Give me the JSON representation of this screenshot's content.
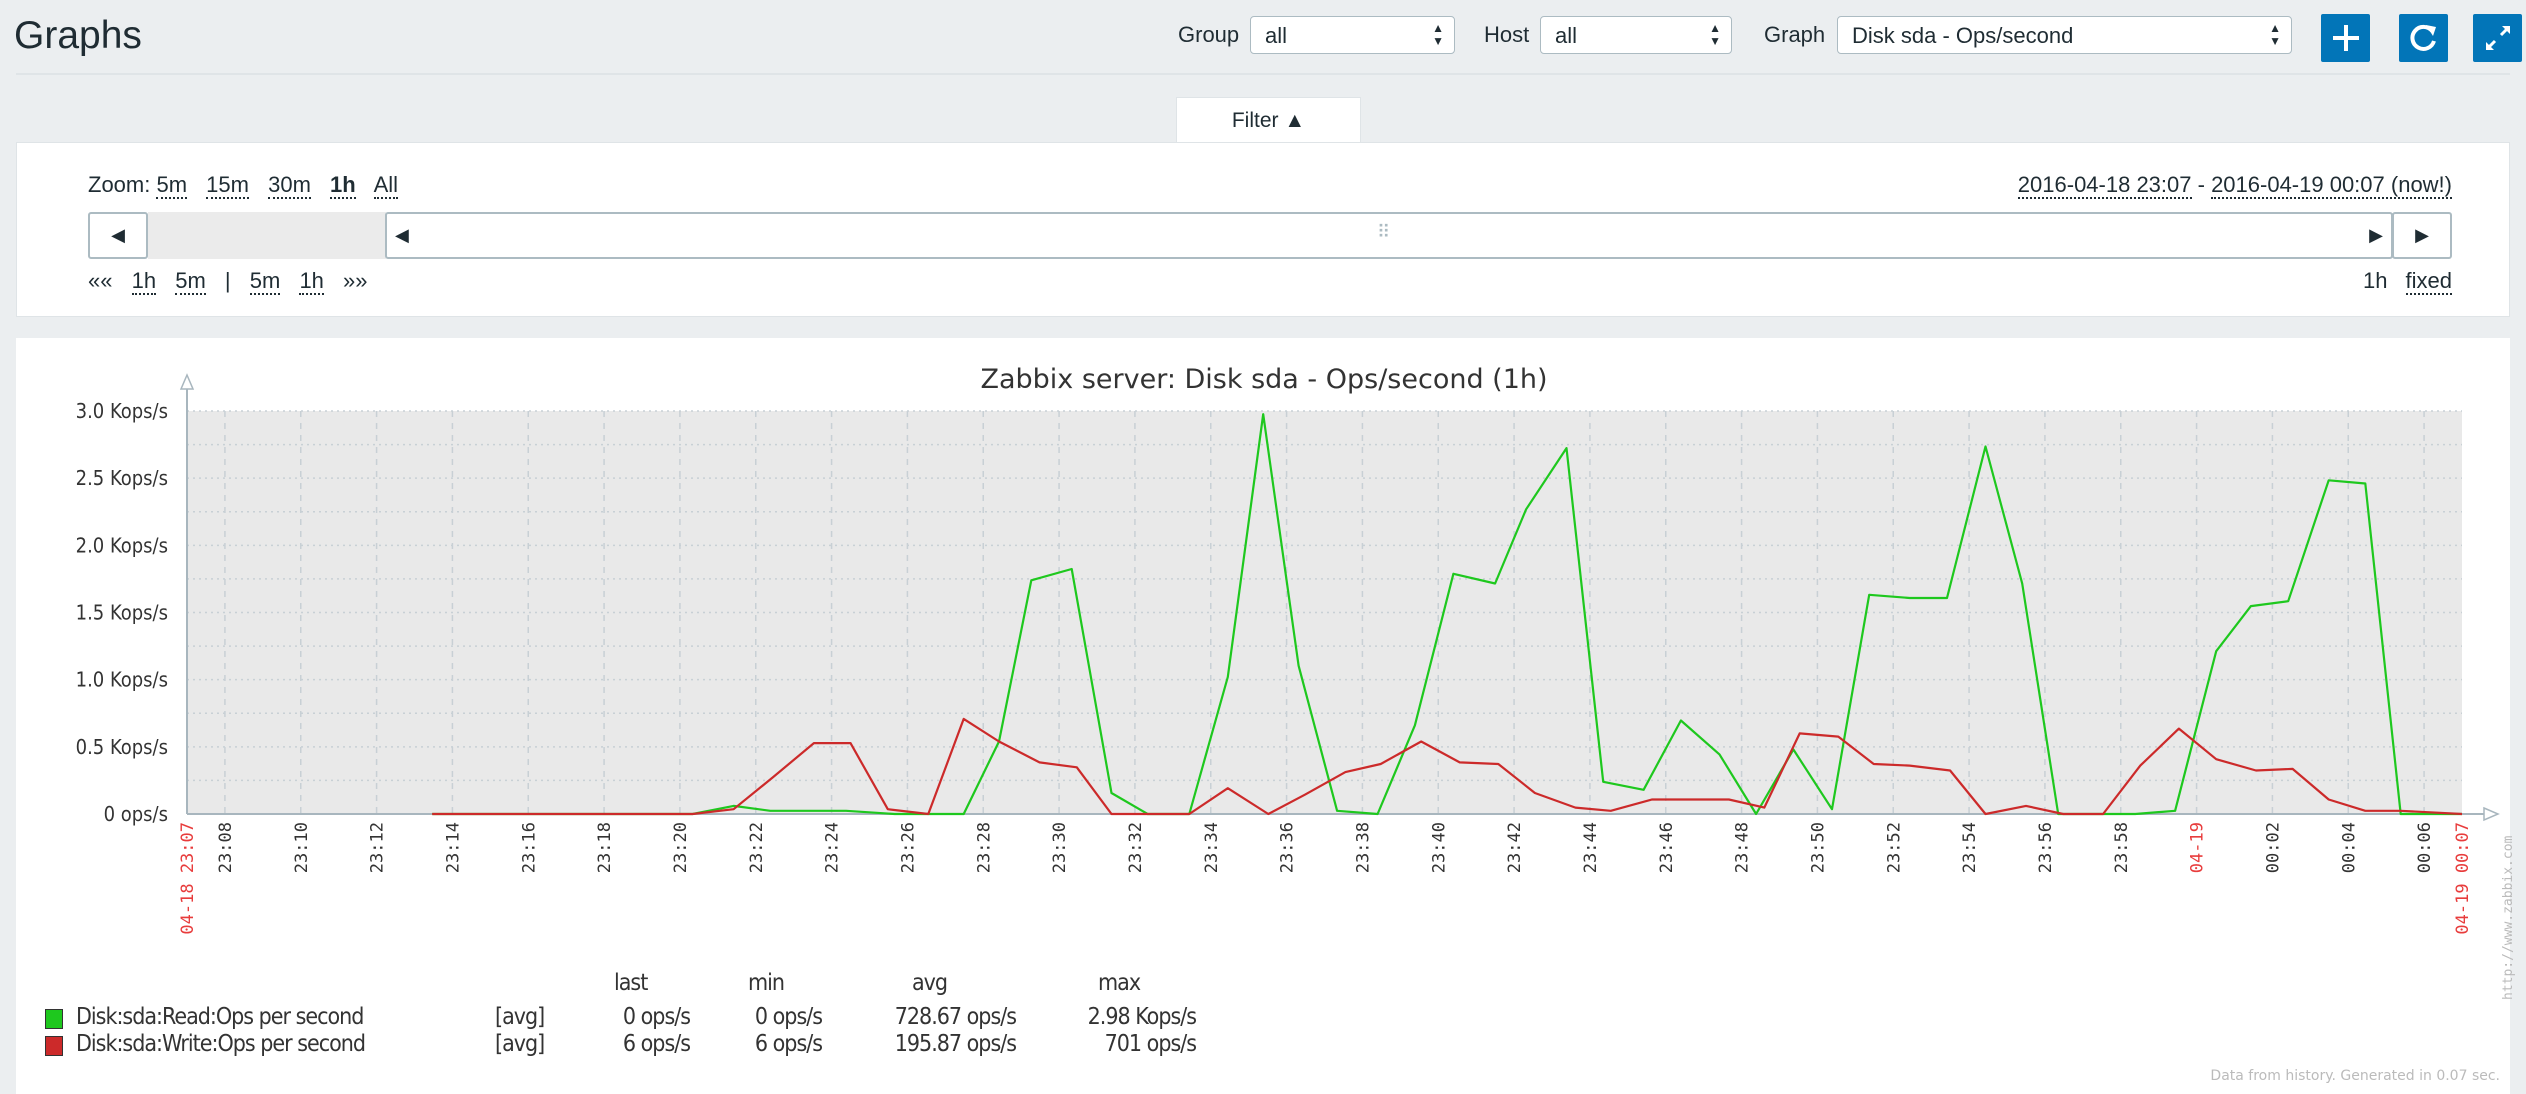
{
  "header": {
    "title": "Graphs",
    "group_label": "Group",
    "group_value": "all",
    "host_label": "Host",
    "host_value": "all",
    "graph_label": "Graph",
    "graph_value": "Disk sda - Ops/second",
    "add_icon": "plus-icon",
    "refresh_icon": "refresh-icon",
    "fullscreen_icon": "fullscreen-icon"
  },
  "filter": {
    "tab_label": "Filter ▲",
    "zoom_label": "Zoom:",
    "zoom_options": [
      "5m",
      "15m",
      "30m",
      "1h",
      "All"
    ],
    "zoom_selected": "1h",
    "range_from": "2016-04-18 23:07",
    "range_sep": " - ",
    "range_to": "2016-04-19 00:07 (now!)",
    "nav_back_all": "««",
    "nav_back_1h": "1h",
    "nav_back_5m": "5m",
    "nav_sep": "|",
    "nav_fwd_5m": "5m",
    "nav_fwd_1h": "1h",
    "nav_fwd_all": "»»",
    "period": "1h",
    "fixed": "fixed"
  },
  "chart_data": {
    "type": "line",
    "title": "Zabbix server: Disk sda - Ops/second (1h)",
    "ylim": [
      0,
      3000
    ],
    "y_ticks": [
      {
        "v": 0,
        "label": "0 ops/s"
      },
      {
        "v": 500,
        "label": "0.5 Kops/s"
      },
      {
        "v": 1000,
        "label": "1.0 Kops/s"
      },
      {
        "v": 1500,
        "label": "1.5 Kops/s"
      },
      {
        "v": 2000,
        "label": "2.0 Kops/s"
      },
      {
        "v": 2500,
        "label": "2.5 Kops/s"
      },
      {
        "v": 3000,
        "label": "3.0 Kops/s"
      }
    ],
    "xlim": [
      "23:07",
      "00:07"
    ],
    "x_ticks": [
      {
        "t": "23:07",
        "label": "04-18 23:07",
        "red": true
      },
      {
        "t": "23:08",
        "label": "23:08"
      },
      {
        "t": "23:10",
        "label": "23:10"
      },
      {
        "t": "23:12",
        "label": "23:12"
      },
      {
        "t": "23:14",
        "label": "23:14"
      },
      {
        "t": "23:16",
        "label": "23:16"
      },
      {
        "t": "23:18",
        "label": "23:18"
      },
      {
        "t": "23:20",
        "label": "23:20"
      },
      {
        "t": "23:22",
        "label": "23:22"
      },
      {
        "t": "23:24",
        "label": "23:24"
      },
      {
        "t": "23:26",
        "label": "23:26"
      },
      {
        "t": "23:28",
        "label": "23:28"
      },
      {
        "t": "23:30",
        "label": "23:30"
      },
      {
        "t": "23:32",
        "label": "23:32"
      },
      {
        "t": "23:34",
        "label": "23:34"
      },
      {
        "t": "23:36",
        "label": "23:36"
      },
      {
        "t": "23:38",
        "label": "23:38"
      },
      {
        "t": "23:40",
        "label": "23:40"
      },
      {
        "t": "23:42",
        "label": "23:42"
      },
      {
        "t": "23:44",
        "label": "23:44"
      },
      {
        "t": "23:46",
        "label": "23:46"
      },
      {
        "t": "23:48",
        "label": "23:48"
      },
      {
        "t": "23:50",
        "label": "23:50"
      },
      {
        "t": "23:52",
        "label": "23:52"
      },
      {
        "t": "23:54",
        "label": "23:54"
      },
      {
        "t": "23:56",
        "label": "23:56"
      },
      {
        "t": "23:58",
        "label": "23:58"
      },
      {
        "t": "00:00",
        "label": "04-19",
        "red": true
      },
      {
        "t": "00:02",
        "label": "00:02"
      },
      {
        "t": "00:04",
        "label": "00:04"
      },
      {
        "t": "00:06",
        "label": "00:06"
      },
      {
        "t": "00:07",
        "label": "04-19 00:07",
        "red": true
      }
    ],
    "grid": true,
    "series": [
      {
        "name": "Disk:sda:Read:Ops per second",
        "color": "#1ec81e",
        "points": [
          [
            "23:13:28",
            0
          ],
          [
            "23:20:20",
            0
          ],
          [
            "23:21:25",
            60
          ],
          [
            "23:22:23",
            24
          ],
          [
            "23:24:23",
            24
          ],
          [
            "23:25:40",
            0
          ],
          [
            "23:26:38",
            0
          ],
          [
            "23:27:29",
            0
          ],
          [
            "23:28:25",
            540
          ],
          [
            "23:29:16",
            1740
          ],
          [
            "23:30:20",
            1824
          ],
          [
            "23:31:23",
            156
          ],
          [
            "23:32:20",
            0
          ],
          [
            "23:33:26",
            0
          ],
          [
            "23:34:27",
            1020
          ],
          [
            "23:35:23",
            2976
          ],
          [
            "23:36:19",
            1104
          ],
          [
            "23:37:20",
            24
          ],
          [
            "23:38:24",
            0
          ],
          [
            "23:39:23",
            660
          ],
          [
            "23:40:24",
            1788
          ],
          [
            "23:41:30",
            1716
          ],
          [
            "23:42:19",
            2268
          ],
          [
            "23:43:23",
            2724
          ],
          [
            "23:44:21",
            240
          ],
          [
            "23:45:25",
            180
          ],
          [
            "23:46:24",
            696
          ],
          [
            "23:47:25",
            444
          ],
          [
            "23:48:23",
            0
          ],
          [
            "23:49:22",
            480
          ],
          [
            "23:50:23",
            36
          ],
          [
            "23:51:22",
            1632
          ],
          [
            "23:52:26",
            1608
          ],
          [
            "23:53:25",
            1608
          ],
          [
            "23:54:26",
            2736
          ],
          [
            "23:55:24",
            1716
          ],
          [
            "23:56:21",
            0
          ],
          [
            "23:57:24",
            0
          ],
          [
            "23:58:23",
            0
          ],
          [
            "23:59:26",
            24
          ],
          [
            "00:00:31",
            1212
          ],
          [
            "00:01:26",
            1548
          ],
          [
            "00:02:25",
            1584
          ],
          [
            "00:03:29",
            2484
          ],
          [
            "00:04:27",
            2460
          ],
          [
            "00:05:23",
            0
          ],
          [
            "00:07:00",
            0
          ]
        ]
      },
      {
        "name": "Disk:sda:Write:Ops per second",
        "color": "#cc2a2a",
        "points": [
          [
            "23:13:28",
            0
          ],
          [
            "23:20:20",
            0
          ],
          [
            "23:21:25",
            36
          ],
          [
            "23:22:28",
            276
          ],
          [
            "23:23:32",
            528
          ],
          [
            "23:24:30",
            528
          ],
          [
            "23:25:29",
            36
          ],
          [
            "23:26:33",
            0
          ],
          [
            "23:27:29",
            708
          ],
          [
            "23:28:25",
            540
          ],
          [
            "23:29:29",
            384
          ],
          [
            "23:30:28",
            348
          ],
          [
            "23:31:23",
            0
          ],
          [
            "23:33:26",
            0
          ],
          [
            "23:34:27",
            192
          ],
          [
            "23:35:31",
            0
          ],
          [
            "23:36:29",
            144
          ],
          [
            "23:37:33",
            312
          ],
          [
            "23:38:29",
            372
          ],
          [
            "23:39:33",
            540
          ],
          [
            "23:40:34",
            384
          ],
          [
            "23:41:35",
            372
          ],
          [
            "23:42:33",
            156
          ],
          [
            "23:43:37",
            48
          ],
          [
            "23:44:33",
            24
          ],
          [
            "23:45:38",
            108
          ],
          [
            "23:47:40",
            108
          ],
          [
            "23:48:36",
            48
          ],
          [
            "23:49:32",
            600
          ],
          [
            "23:50:33",
            576
          ],
          [
            "23:51:29",
            372
          ],
          [
            "23:52:26",
            360
          ],
          [
            "23:53:30",
            324
          ],
          [
            "23:54:26",
            0
          ],
          [
            "23:55:30",
            60
          ],
          [
            "23:56:29",
            0
          ],
          [
            "23:57:32",
            0
          ],
          [
            "23:58:31",
            360
          ],
          [
            "23:59:32",
            636
          ],
          [
            "00:00:31",
            408
          ],
          [
            "00:01:34",
            324
          ],
          [
            "00:02:32",
            336
          ],
          [
            "00:03:29",
            108
          ],
          [
            "00:04:27",
            24
          ],
          [
            "00:05:23",
            24
          ],
          [
            "00:07:00",
            0
          ]
        ]
      }
    ]
  },
  "legend": {
    "headers": {
      "last": "last",
      "min": "min",
      "avg": "avg",
      "max": "max"
    },
    "rows": [
      {
        "name": "Disk:sda:Read:Ops per second",
        "func": "[avg]",
        "last": "0 ops/s",
        "min": "0 ops/s",
        "avg": "728.67 ops/s",
        "max": "2.98 Kops/s",
        "color": "#1ec81e"
      },
      {
        "name": "Disk:sda:Write:Ops per second",
        "func": "[avg]",
        "last": "6 ops/s",
        "min": "6 ops/s",
        "avg": "195.87 ops/s",
        "max": "701 ops/s",
        "color": "#cc2a2a"
      }
    ]
  },
  "watermark": "http://www.zabbix.com",
  "footer": "Data from history. Generated in 0.07 sec."
}
